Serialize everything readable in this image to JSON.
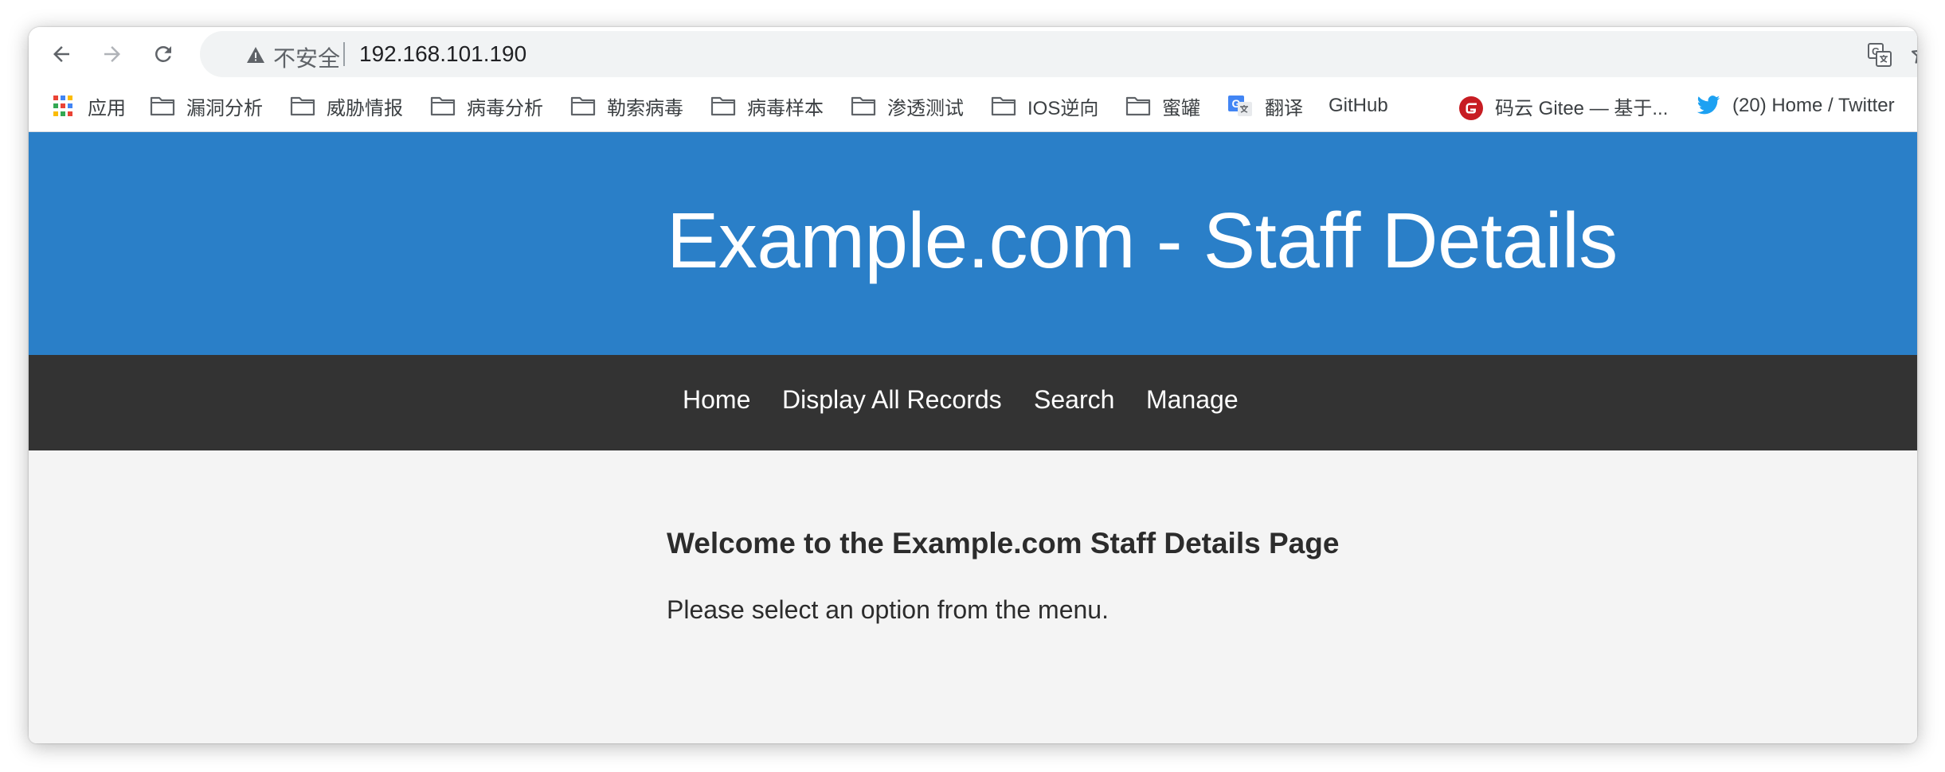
{
  "browser": {
    "address_bar": {
      "security_label": "不安全",
      "url": "192.168.101.190"
    },
    "bookmarks": [
      {
        "label": "应用",
        "icon": "apps-grid-icon"
      },
      {
        "label": "漏洞分析",
        "icon": "folder-icon"
      },
      {
        "label": "威胁情报",
        "icon": "folder-icon"
      },
      {
        "label": "病毒分析",
        "icon": "folder-icon"
      },
      {
        "label": "勒索病毒",
        "icon": "folder-icon"
      },
      {
        "label": "病毒样本",
        "icon": "folder-icon"
      },
      {
        "label": "渗透测试",
        "icon": "folder-icon"
      },
      {
        "label": "IOS逆向",
        "icon": "folder-icon"
      },
      {
        "label": "蜜罐",
        "icon": "folder-icon"
      },
      {
        "label": "翻译",
        "icon": "google-translate-icon"
      },
      {
        "label": "GitHub",
        "icon": "github-icon"
      },
      {
        "label": "码云 Gitee — 基于...",
        "icon": "gitee-icon"
      },
      {
        "label": "(20) Home / Twitter",
        "icon": "twitter-icon"
      }
    ]
  },
  "page": {
    "title": "Example.com - Staff Details",
    "menu": [
      "Home",
      "Display All Records",
      "Search",
      "Manage"
    ],
    "heading": "Welcome to the Example.com Staff Details Page",
    "message": "Please select an option from the menu."
  },
  "colors": {
    "header_bg": "#2a7fc8",
    "menu_bg": "#333333",
    "content_bg": "#f4f4f4",
    "gitee_red": "#c71d23",
    "twitter_blue": "#1da1f2"
  }
}
